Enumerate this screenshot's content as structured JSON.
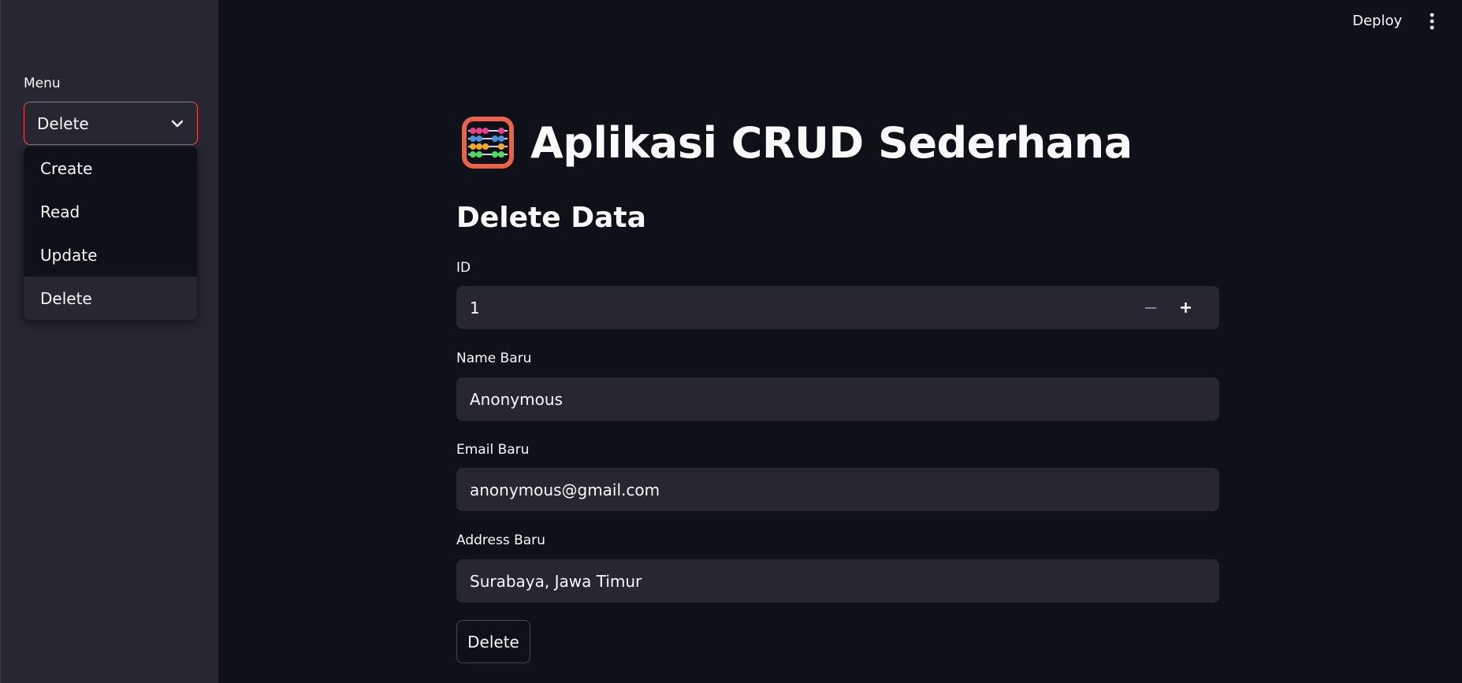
{
  "sidebar": {
    "menu_label": "Menu",
    "selected": "Delete",
    "options": [
      "Create",
      "Read",
      "Update",
      "Delete"
    ]
  },
  "header": {
    "deploy_label": "Deploy"
  },
  "main": {
    "title": "Aplikasi CRUD Sederhana",
    "title_icon": "abacus-icon",
    "subtitle": "Delete Data",
    "fields": {
      "id": {
        "label": "ID",
        "value": "1"
      },
      "name": {
        "label": "Name Baru",
        "value": "Anonymous"
      },
      "email": {
        "label": "Email Baru",
        "value": "anonymous@gmail.com"
      },
      "address": {
        "label": "Address Baru",
        "value": "Surabaya, Jawa Timur"
      }
    },
    "delete_button_label": "Delete"
  },
  "colors": {
    "background": "#0e1117",
    "sidebar": "#262730",
    "input_bg": "#262730",
    "accent": "#ff4b4b",
    "text": "#fafafa"
  }
}
